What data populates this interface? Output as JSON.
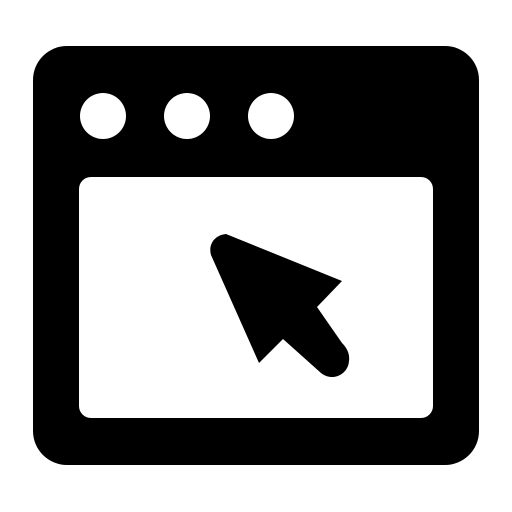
{
  "icon": {
    "name": "browser-window-cursor-icon",
    "fg_color": "#000000",
    "bg_color": "#ffffff",
    "window_dots": [
      "dot-1",
      "dot-2",
      "dot-3"
    ]
  }
}
